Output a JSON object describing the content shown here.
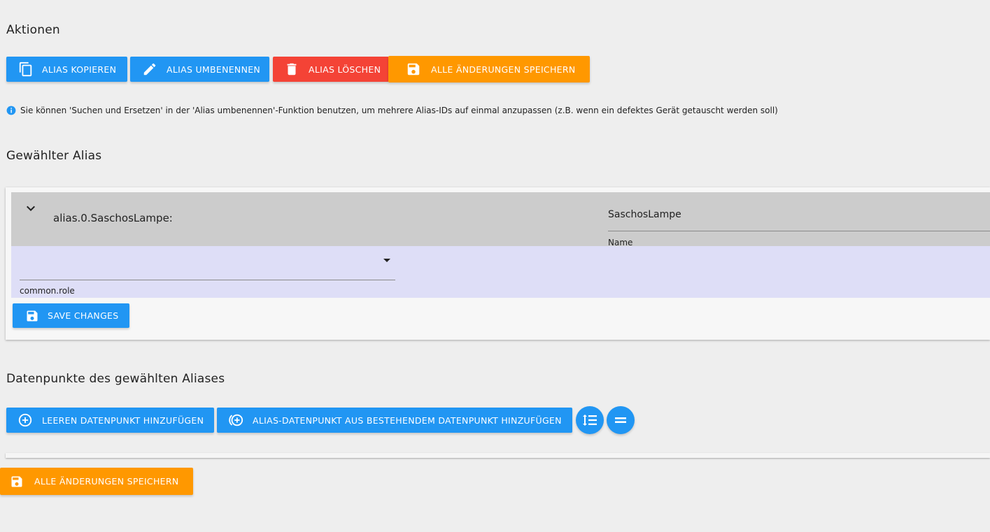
{
  "actions": {
    "heading": "Aktionen",
    "copy_label": "ALIAS KOPIEREN",
    "rename_label": "ALIAS UMBENENNEN",
    "delete_label": "ALIAS LÖSCHEN",
    "save_all_label": "ALLE ÄNDERUNGEN SPEICHERN"
  },
  "info": {
    "text": "Sie können 'Suchen und Ersetzen' in der 'Alias umbenennen'-Funktion benutzen, um mehrere Alias-IDs auf einmal anzupassen (z.B. wenn ein defektes Gerät getauscht werden soll)"
  },
  "selected_alias": {
    "heading": "Gewählter Alias",
    "alias_id": "alias.0.SaschosLampe:",
    "name_value": "SaschosLampe",
    "name_label": "Name",
    "role_value": "",
    "role_label": "common.role",
    "save_label": "SAVE CHANGES"
  },
  "datapoints": {
    "heading": "Datenpunkte des gewählten Aliases",
    "add_empty_label": "LEEREN DATENPUNKT HINZUFÜGEN",
    "add_from_existing_label": "ALIAS-DATENPUNKT AUS BESTEHENDEM DATENPUNKT HINZUFÜGEN"
  },
  "footer": {
    "save_all_label": "ALLE ÄNDERUNGEN SPEICHERN"
  },
  "colors": {
    "primary": "#2196f3",
    "danger": "#f44336",
    "warning": "#ff9800",
    "background": "#eeeeee",
    "alias_header": "#cccccc",
    "alias_field_row": "#dedef7"
  },
  "icons": {
    "copy": "copy-icon",
    "rename": "pencil-icon",
    "delete": "trash-icon",
    "save": "save-icon",
    "info": "info-icon",
    "expand": "chevron-down-icon",
    "dropdown": "caret-down-icon",
    "add": "plus-circle-icon",
    "add_existing": "add-link-circle-icon",
    "expand_all": "expand-lines-icon",
    "collapse_all": "equals-icon"
  }
}
